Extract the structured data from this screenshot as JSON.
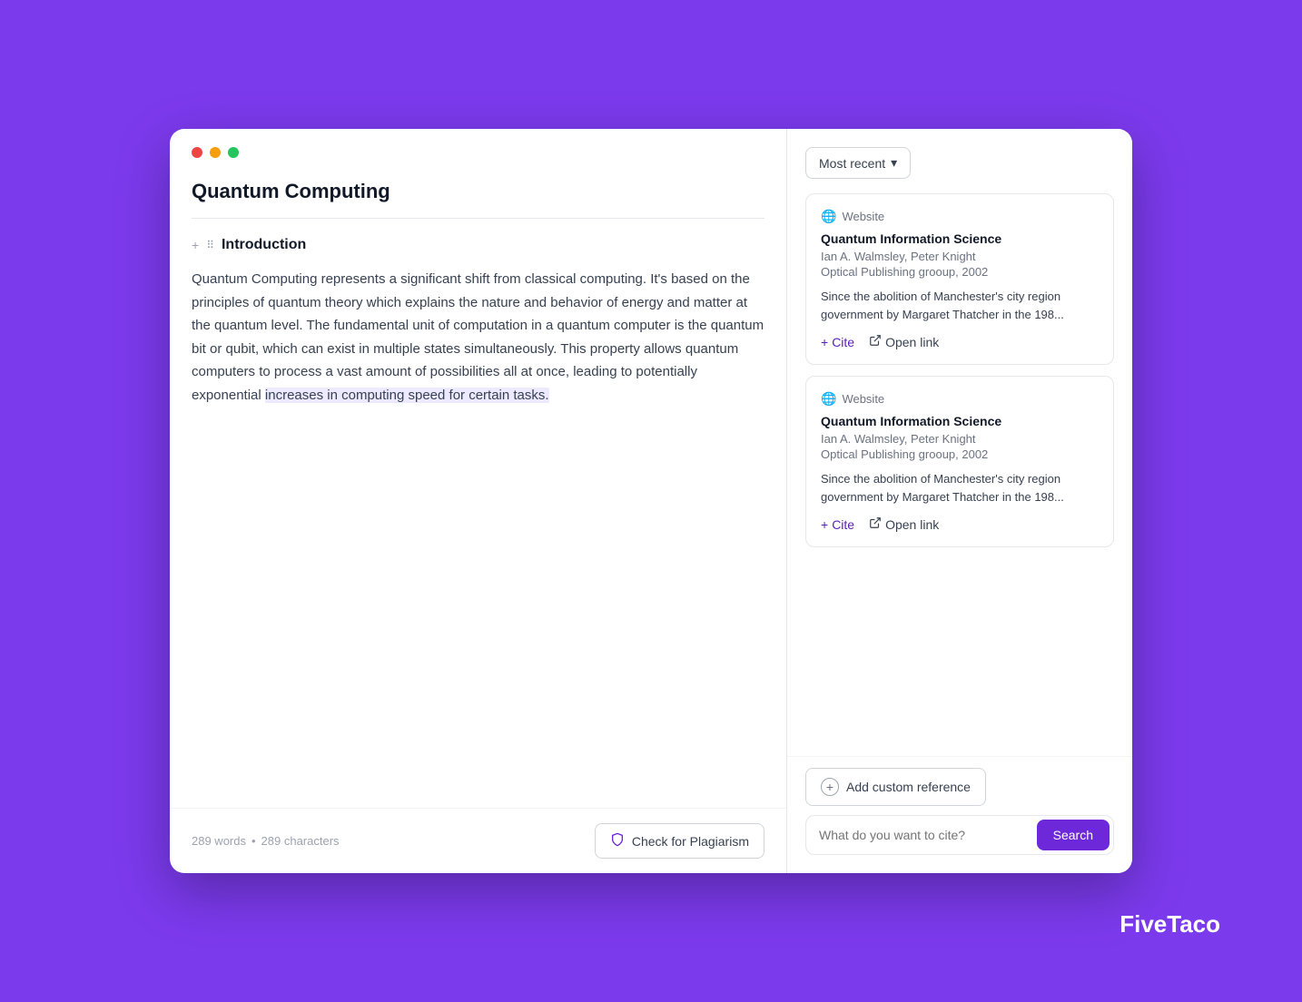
{
  "window": {
    "title": "Quantum Computing"
  },
  "left_panel": {
    "doc_title": "Quantum Computing",
    "section_title": "Introduction",
    "section_body_normal": "Quantum Computing represents a significant shift from classical computing. It's based on the principles of quantum theory which explains the nature and behavior of energy and matter at the quantum level. The fundamental unit of computation in a quantum computer is the quantum bit or qubit, which can exist in multiple states simultaneously. This property allows quantum computers to process a vast amount of possibilities all at once, leading to potentially exponential ",
    "section_body_highlighted": "increases in computing speed for certain tasks.",
    "word_count": "289 words",
    "char_count": "289 characters",
    "plagiarism_btn": "Check for Plagiarism"
  },
  "right_panel": {
    "sort_label": "Most recent",
    "references": [
      {
        "type": "Website",
        "title": "Quantum Information Science",
        "authors": "Ian A. Walmsley, Peter Knight",
        "publisher": "Optical Publishing grooup, 2002",
        "excerpt": "Since the abolition of Manchester's city region government by Margaret Thatcher in the 198...",
        "cite_label": "Cite",
        "open_link_label": "Open link"
      },
      {
        "type": "Website",
        "title": "Quantum Information Science",
        "authors": "Ian A. Walmsley, Peter Knight",
        "publisher": "Optical Publishing grooup, 2002",
        "excerpt": "Since the abolition of Manchester's city region government by Margaret Thatcher in the 198...",
        "cite_label": "Cite",
        "open_link_label": "Open link"
      }
    ],
    "add_custom_ref": "Add custom reference",
    "search_placeholder": "What do you want to cite?",
    "search_btn": "Search"
  },
  "brand": {
    "name": "FiveTaco"
  }
}
